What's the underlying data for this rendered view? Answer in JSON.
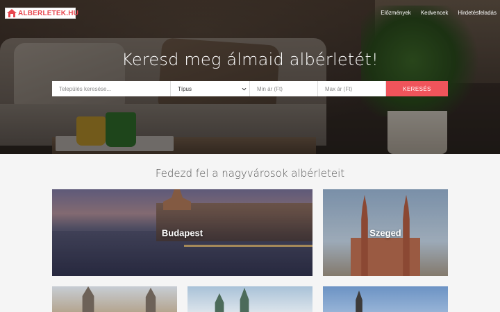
{
  "header": {
    "logo_text": "ALBERLETEK.HU",
    "nav": [
      "Előzmények",
      "Kedvencek",
      "Hirdetésfeladás"
    ]
  },
  "hero": {
    "headline": "Keresd meg álmaid albérletét!"
  },
  "search": {
    "city_placeholder": "Település keresése...",
    "type_value": "Típus",
    "min_placeholder": "Min ár (Ft)",
    "max_placeholder": "Max ár (Ft)",
    "button_label": "KERESÉS"
  },
  "cities": {
    "title": "Fedezd fel a nagyvárosok albérleteit",
    "items": [
      "Budapest",
      "Szeged"
    ]
  },
  "colors": {
    "accent": "#f0545b",
    "logo_red": "#e8474f"
  }
}
